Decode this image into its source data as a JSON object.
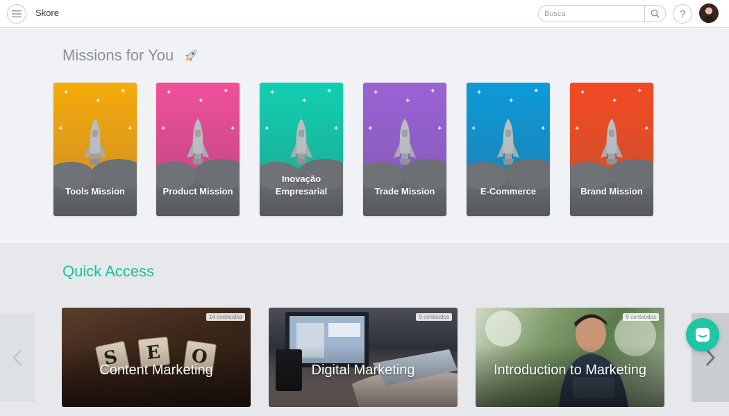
{
  "header": {
    "app_title": "Skore",
    "search_placeholder": "Busca",
    "help_label": "?",
    "icons": {
      "menu": "hamburger-icon",
      "search": "search-icon",
      "avatar": "user-avatar"
    }
  },
  "missions": {
    "title": "Missions for You",
    "title_icon": "rocket-icon",
    "cards": [
      {
        "label": "Tools Mission",
        "color_top": "#f5ac0a",
        "color_bottom": "#c98a2a"
      },
      {
        "label": "Product Mission",
        "color_top": "#f0509a",
        "color_bottom": "#b9467e"
      },
      {
        "label": "Inovação Empresarial",
        "color_top": "#12cfb1",
        "color_bottom": "#1ea590"
      },
      {
        "label": "Trade Mission",
        "color_top": "#9a63d6",
        "color_bottom": "#8158b0"
      },
      {
        "label": "E-Commerce",
        "color_top": "#0c9ad8",
        "color_bottom": "#1f7fae"
      },
      {
        "label": "Brand Mission",
        "color_top": "#f24a22",
        "color_bottom": "#c9502f"
      }
    ]
  },
  "quick_access": {
    "title": "Quick Access",
    "cards": [
      {
        "title": "Content Marketing",
        "badge": "14 conteúdos",
        "image": "seo-wooden-tiles"
      },
      {
        "title": "Digital Marketing",
        "badge": "9 conteúdos",
        "image": "laptop-typing"
      },
      {
        "title": "Introduction to Marketing",
        "badge": "9 conteúdos",
        "image": "man-smiling-reading"
      }
    ],
    "prev_icon": "chevron-left-icon",
    "next_icon": "chevron-right-icon"
  },
  "chat": {
    "icon": "chat-icon",
    "color": "#1fc6a6"
  },
  "colors": {
    "accent": "#1bbfa0",
    "mission_title": "#8a8f96"
  }
}
